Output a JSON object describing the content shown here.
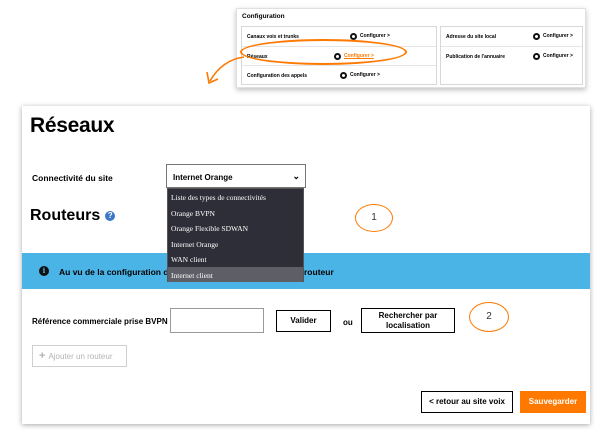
{
  "inset": {
    "title": "Configuration",
    "left_rows": [
      {
        "label": "Canaux voix et trunks",
        "action": "Configurer >"
      },
      {
        "label": "Réseaux",
        "action": "Configurer >"
      },
      {
        "label": "Configuration des appels",
        "action": "Configurer >"
      }
    ],
    "right_rows": [
      {
        "label": "Adresse du site local",
        "action": "Configurer >"
      },
      {
        "label": "Publication de l'annuaire",
        "action": "Configurer >"
      }
    ],
    "highlight_color": "#ff7900"
  },
  "page": {
    "title": "Réseaux",
    "connectivity": {
      "label": "Connectivité du site",
      "selected": "Internet Orange",
      "options": [
        "Liste des types de connectivités",
        "Orange BVPN",
        "Orange Flexible SDWAN",
        "Internet Orange",
        "WAN client",
        "Internet client"
      ],
      "highlighted_option": "Internet client"
    },
    "routers": {
      "title": "Routeurs",
      "help_icon": "question-circle-icon"
    },
    "info": {
      "icon": "info-circle-icon",
      "text_visible_left": "Au vu de la configuration du site",
      "text_visible_right": "routeur",
      "bg_color": "#4bb4e6"
    },
    "reference": {
      "label": "Référence commerciale prise BVPN",
      "value": "",
      "validate_label": "Valider",
      "or_label": "ou",
      "search_label_line1": "Rechercher par",
      "search_label_line2": "localisation"
    },
    "add_router_label": "Ajouter un routeur",
    "back_label": "< retour au site voix",
    "save_label": "Sauvegarder",
    "accent_color": "#ff7900"
  },
  "callouts": [
    "1",
    "2"
  ]
}
